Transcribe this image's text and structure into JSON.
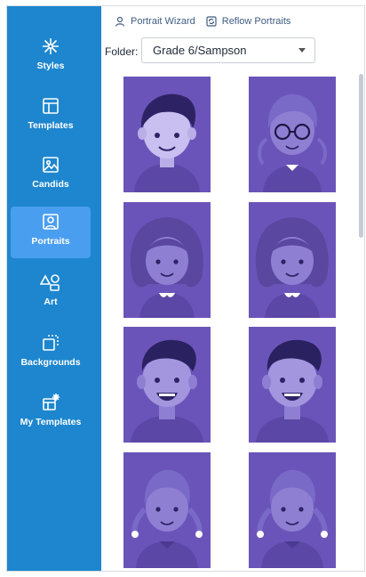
{
  "sidebar": {
    "items": [
      {
        "label": "Styles",
        "icon": "sparkle-icon"
      },
      {
        "label": "Templates",
        "icon": "layout-icon"
      },
      {
        "label": "Candids",
        "icon": "photo-icon"
      },
      {
        "label": "Portraits",
        "icon": "portrait-icon",
        "active": true
      },
      {
        "label": "Art",
        "icon": "shapes-icon"
      },
      {
        "label": "Backgrounds",
        "icon": "background-icon"
      },
      {
        "label": "My Templates",
        "icon": "my-templates-icon"
      }
    ]
  },
  "toolbar": {
    "portrait_wizard": "Portrait Wizard",
    "reflow_portraits": "Reflow Portraits"
  },
  "folder": {
    "label": "Folder:",
    "selected": "Grade 6/Sampson"
  },
  "portraits": [
    {
      "type": "boy-hair"
    },
    {
      "type": "girl-glasses"
    },
    {
      "type": "girl-curly"
    },
    {
      "type": "girl-curly"
    },
    {
      "type": "boy-smile"
    },
    {
      "type": "boy-smile"
    },
    {
      "type": "girl-pigtails"
    },
    {
      "type": "girl-pigtails"
    }
  ],
  "colors": {
    "sidebar": "#1d86ce",
    "sidebar_active": "#4a9ef0",
    "portrait_bg": "#6b54b9"
  }
}
